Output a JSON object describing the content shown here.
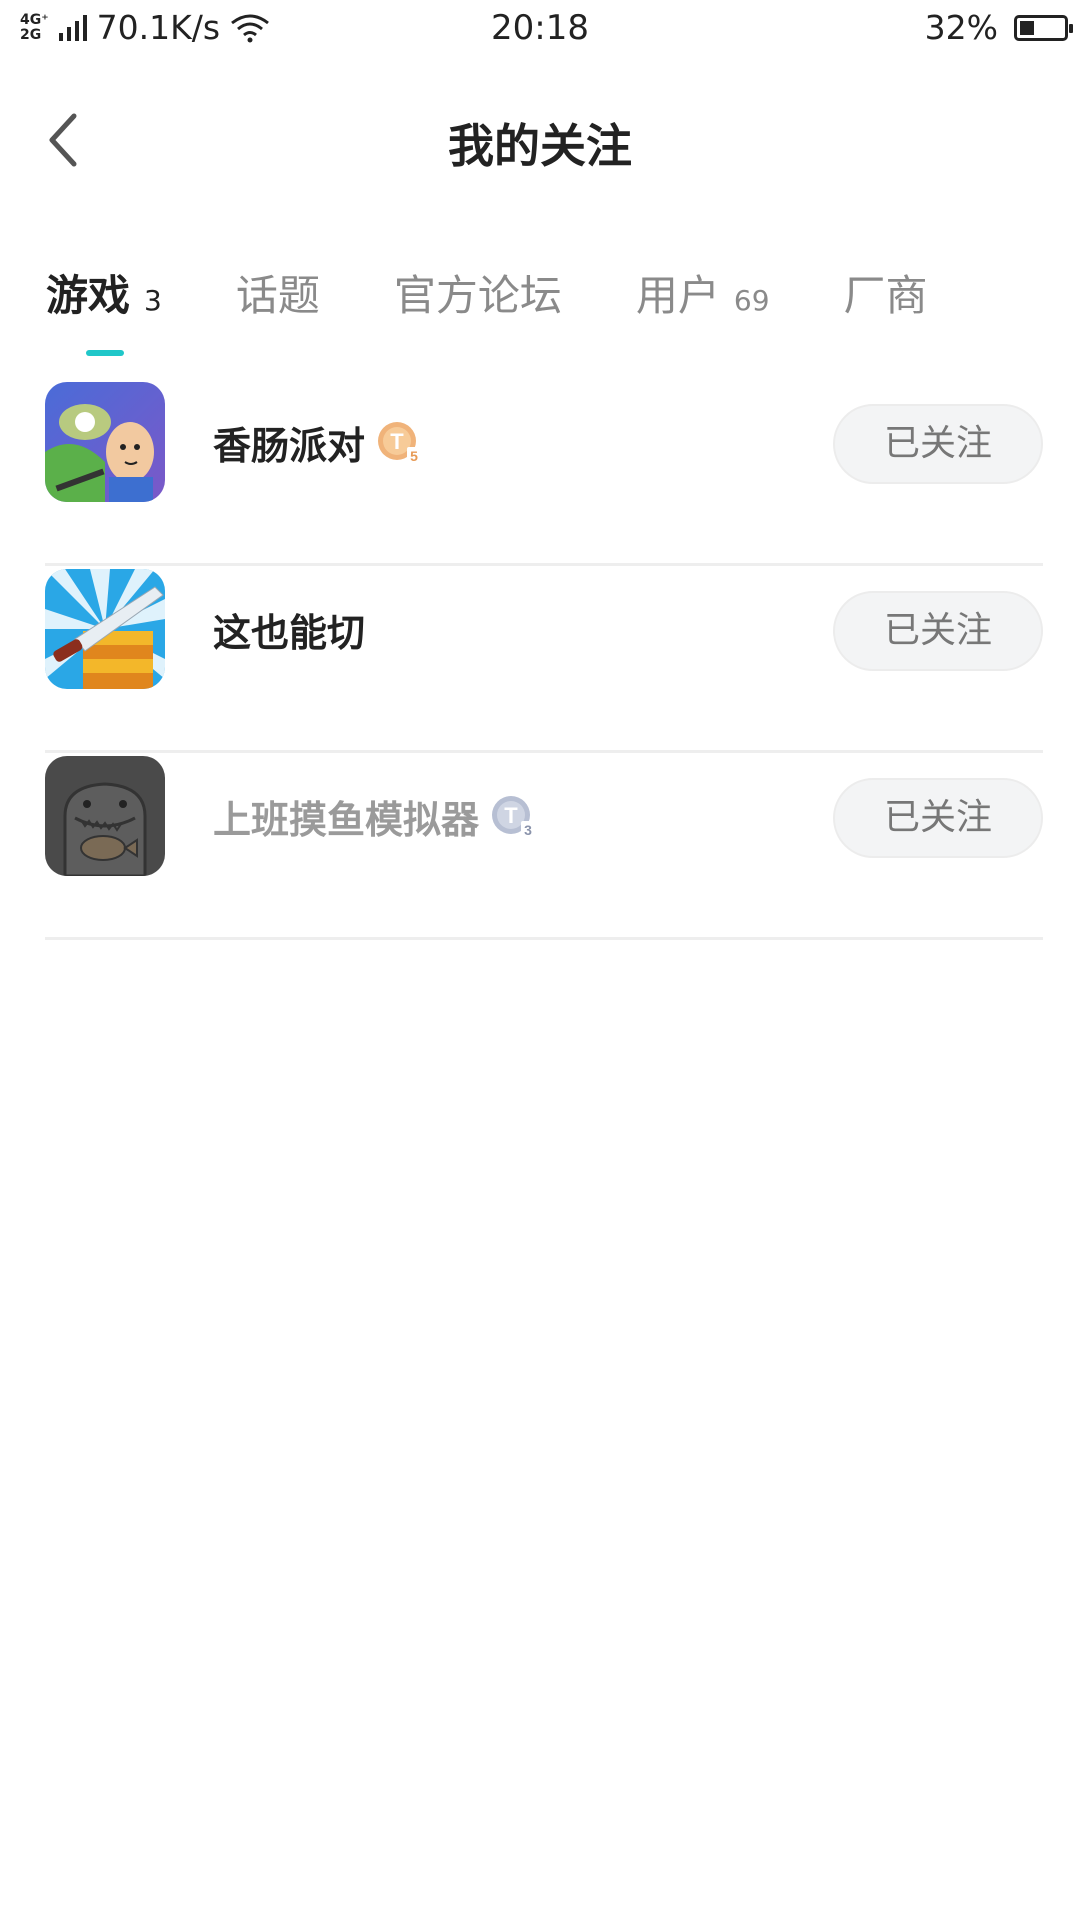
{
  "status_bar": {
    "network_top": "4G⁺",
    "network_bottom": "2G",
    "speed": "70.1K/s",
    "time": "20:18",
    "battery": "32%"
  },
  "header": {
    "title": "我的关注"
  },
  "tabs": [
    {
      "label": "游戏",
      "count": "3",
      "active": true
    },
    {
      "label": "话题",
      "count": ""
    },
    {
      "label": "官方论坛",
      "count": ""
    },
    {
      "label": "用户",
      "count": "69"
    },
    {
      "label": "厂商",
      "count": ""
    }
  ],
  "games": [
    {
      "name": "香肠派对",
      "badge": "T",
      "badge_level": "5",
      "badge_color": "#f0b37a",
      "button": "已关注"
    },
    {
      "name": "这也能切",
      "button": "已关注"
    },
    {
      "name": "上班摸鱼模拟器",
      "badge": "T",
      "badge_level": "3",
      "badge_color": "#b7bfd3",
      "button": "已关注"
    }
  ],
  "colors": {
    "accent": "#20c7c9"
  }
}
